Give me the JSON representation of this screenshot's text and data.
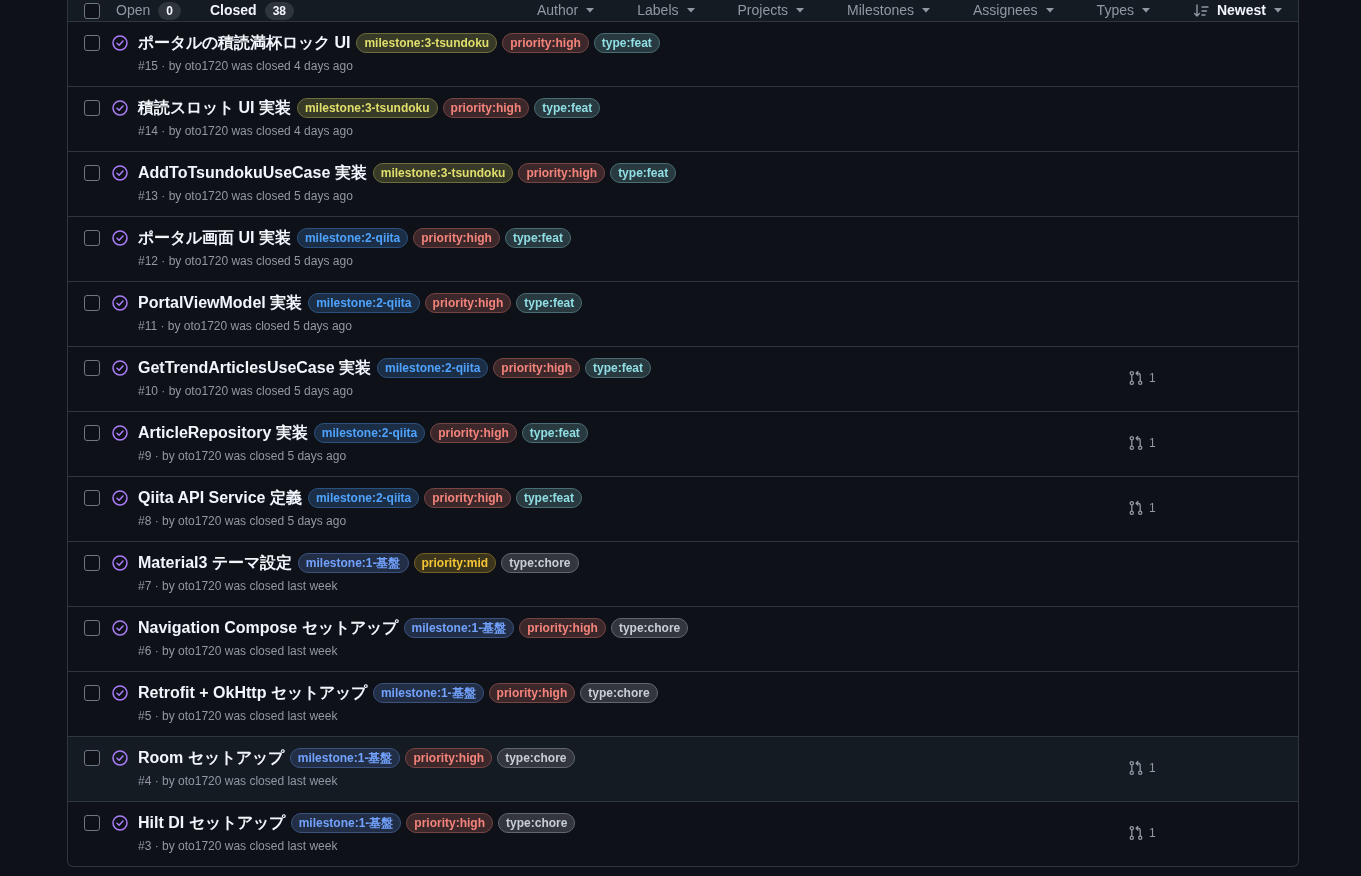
{
  "header": {
    "checked": false,
    "tabs": [
      {
        "label": "Open",
        "count": "0",
        "selected": false
      },
      {
        "label": "Closed",
        "count": "38",
        "selected": true
      }
    ],
    "filters": [
      "Author",
      "Labels",
      "Projects",
      "Milestones",
      "Assignees",
      "Types"
    ],
    "sort": "Newest"
  },
  "rows": [
    {
      "closed": true,
      "checked": false,
      "highlighted": false,
      "title": "ポータルの積読満杯ロック UI",
      "labels": [
        {
          "text": "milestone:3-tsundoku",
          "color": "#383a28"
        },
        {
          "text": "priority:high",
          "color": "#3c282b"
        },
        {
          "text": "type:feat",
          "color": "#283a40"
        }
      ],
      "meta": "#15 · by oto1720 was closed 4 days ago"
    },
    {
      "closed": true,
      "checked": false,
      "highlighted": false,
      "title": "積読スロット UI 実装",
      "labels": [
        {
          "text": "milestone:3-tsundoku",
          "color": "#383a28"
        },
        {
          "text": "priority:high",
          "color": "#3c282b"
        },
        {
          "text": "type:feat",
          "color": "#283a40"
        }
      ],
      "meta": "#14 · by oto1720 was closed 4 days ago"
    },
    {
      "closed": true,
      "checked": false,
      "highlighted": false,
      "title": "AddToTsundokuUseCase 実装",
      "labels": [
        {
          "text": "milestone:3-tsundoku",
          "color": "#383a28"
        },
        {
          "text": "priority:high",
          "color": "#3c282b"
        },
        {
          "text": "type:feat",
          "color": "#283a40"
        }
      ],
      "meta": "#13 · by oto1720 was closed 5 days ago"
    },
    {
      "closed": true,
      "checked": false,
      "highlighted": false,
      "title": "ポータル画面 UI 実装",
      "labels": [
        {
          "text": "milestone:2-qiita",
          "color": "#1b2e45"
        },
        {
          "text": "priority:high",
          "color": "#3c282b"
        },
        {
          "text": "type:feat",
          "color": "#283a40"
        }
      ],
      "meta": "#12 · by oto1720 was closed 5 days ago"
    },
    {
      "closed": true,
      "checked": false,
      "highlighted": false,
      "title": "PortalViewModel 実装",
      "labels": [
        {
          "text": "milestone:2-qiita",
          "color": "#1b2e45"
        },
        {
          "text": "priority:high",
          "color": "#3c282b"
        },
        {
          "text": "type:feat",
          "color": "#283a40"
        }
      ],
      "meta": "#11 · by oto1720 was closed 5 days ago"
    },
    {
      "closed": true,
      "checked": false,
      "highlighted": false,
      "title": "GetTrendArticlesUseCase 実装",
      "labels": [
        {
          "text": "milestone:2-qiita",
          "color": "#1b2e45"
        },
        {
          "text": "priority:high",
          "color": "#3c282b"
        },
        {
          "text": "type:feat",
          "color": "#283a40"
        }
      ],
      "meta": "#10 · by oto1720 was closed 5 days ago",
      "linked_prs": "1"
    },
    {
      "closed": true,
      "checked": false,
      "highlighted": false,
      "title": "ArticleRepository 実装",
      "labels": [
        {
          "text": "milestone:2-qiita",
          "color": "#1b2e45"
        },
        {
          "text": "priority:high",
          "color": "#3c282b"
        },
        {
          "text": "type:feat",
          "color": "#283a40"
        }
      ],
      "meta": "#9 · by oto1720 was closed 5 days ago",
      "linked_prs": "1"
    },
    {
      "closed": true,
      "checked": false,
      "highlighted": false,
      "title": "Qiita API Service 定義",
      "labels": [
        {
          "text": "milestone:2-qiita",
          "color": "#1b2e45"
        },
        {
          "text": "priority:high",
          "color": "#3c282b"
        },
        {
          "text": "type:feat",
          "color": "#283a40"
        }
      ],
      "meta": "#8 · by oto1720 was closed 5 days ago",
      "linked_prs": "1"
    },
    {
      "closed": true,
      "checked": false,
      "highlighted": false,
      "title": "Material3 テーマ設定",
      "labels": [
        {
          "text": "milestone:1-基盤",
          "color": "#222e45"
        },
        {
          "text": "priority:mid",
          "color": "#3c351d"
        },
        {
          "text": "type:chore",
          "color": "#33373d"
        }
      ],
      "meta": "#7 · by oto1720 was closed last week"
    },
    {
      "closed": true,
      "checked": false,
      "highlighted": false,
      "title": "Navigation Compose セットアップ",
      "labels": [
        {
          "text": "milestone:1-基盤",
          "color": "#222e45"
        },
        {
          "text": "priority:high",
          "color": "#3c282b"
        },
        {
          "text": "type:chore",
          "color": "#33373d"
        }
      ],
      "meta": "#6 · by oto1720 was closed last week"
    },
    {
      "closed": true,
      "checked": false,
      "highlighted": false,
      "title": "Retrofit + OkHttp セットアップ",
      "labels": [
        {
          "text": "milestone:1-基盤",
          "color": "#222e45"
        },
        {
          "text": "priority:high",
          "color": "#3c282b"
        },
        {
          "text": "type:chore",
          "color": "#33373d"
        }
      ],
      "meta": "#5 · by oto1720 was closed last week"
    },
    {
      "closed": true,
      "checked": false,
      "highlighted": true,
      "title": "Room セットアップ",
      "labels": [
        {
          "text": "milestone:1-基盤",
          "color": "#222e45"
        },
        {
          "text": "priority:high",
          "color": "#3c282b"
        },
        {
          "text": "type:chore",
          "color": "#33373d"
        }
      ],
      "meta": "#4 · by oto1720 was closed last week",
      "linked_prs": "1"
    },
    {
      "closed": true,
      "checked": false,
      "highlighted": false,
      "title": "Hilt DI セットアップ",
      "labels": [
        {
          "text": "milestone:1-基盤",
          "color": "#222e45"
        },
        {
          "text": "priority:high",
          "color": "#3c282b"
        },
        {
          "text": "type:chore",
          "color": "#33373d"
        }
      ],
      "meta": "#3 · by oto1720 was closed last week",
      "linked_prs": "1"
    }
  ]
}
